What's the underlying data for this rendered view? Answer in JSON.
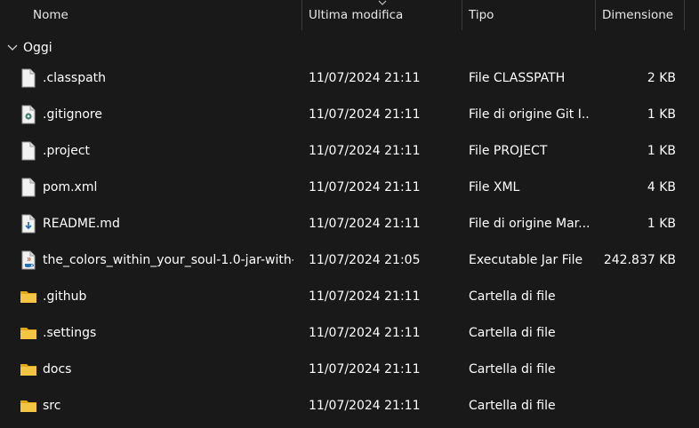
{
  "columns": {
    "name": "Nome",
    "modified": "Ultima modifica",
    "type": "Tipo",
    "size": "Dimensione"
  },
  "group": {
    "label": "Oggi"
  },
  "files": [
    {
      "name": ".classpath",
      "modified": "11/07/2024 21:11",
      "type": "File CLASSPATH",
      "size": "2 KB",
      "icon": "blank-file-icon"
    },
    {
      "name": ".gitignore",
      "modified": "11/07/2024 21:11",
      "type": "File di origine Git I...",
      "size": "1 KB",
      "icon": "gear-file-icon"
    },
    {
      "name": ".project",
      "modified": "11/07/2024 21:11",
      "type": "File PROJECT",
      "size": "1 KB",
      "icon": "blank-file-icon"
    },
    {
      "name": "pom.xml",
      "modified": "11/07/2024 21:11",
      "type": "File XML",
      "size": "4 KB",
      "icon": "blank-file-icon"
    },
    {
      "name": "README.md",
      "modified": "11/07/2024 21:11",
      "type": "File di origine Mar...",
      "size": "1 KB",
      "icon": "markdown-file-icon"
    },
    {
      "name": "the_colors_within_your_soul-1.0-jar-with-...",
      "modified": "11/07/2024 21:05",
      "type": "Executable Jar File",
      "size": "242.837 KB",
      "icon": "java-jar-icon"
    },
    {
      "name": ".github",
      "modified": "11/07/2024 21:11",
      "type": "Cartella di file",
      "size": "",
      "icon": "folder-icon"
    },
    {
      "name": ".settings",
      "modified": "11/07/2024 21:11",
      "type": "Cartella di file",
      "size": "",
      "icon": "folder-icon"
    },
    {
      "name": "docs",
      "modified": "11/07/2024 21:11",
      "type": "Cartella di file",
      "size": "",
      "icon": "folder-icon"
    },
    {
      "name": "src",
      "modified": "11/07/2024 21:11",
      "type": "Cartella di file",
      "size": "",
      "icon": "folder-icon"
    }
  ],
  "colors": {
    "background": "#191919",
    "folder": "#f4c542",
    "separator": "#3a3a3a"
  }
}
